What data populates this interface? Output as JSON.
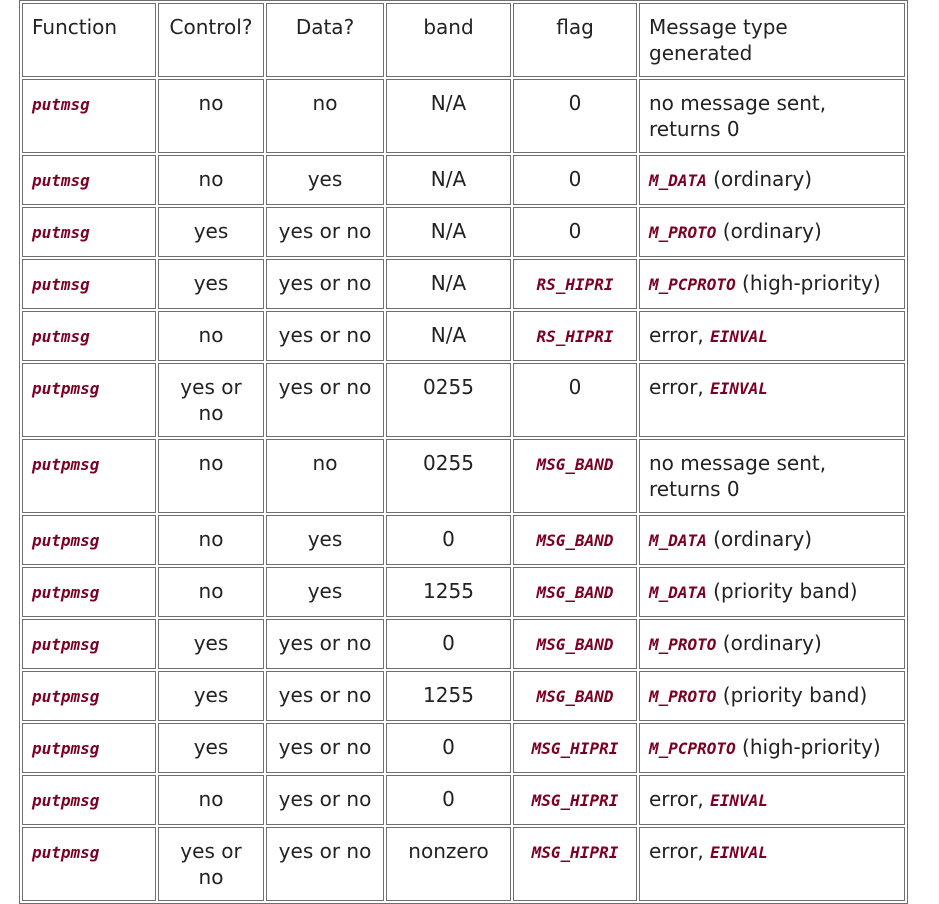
{
  "headers": [
    "Function",
    "Control?",
    "Data?",
    "band",
    "flag",
    "Message type generated"
  ],
  "rows": [
    {
      "function": "putmsg",
      "control": "no",
      "data": "no",
      "band": "N/A",
      "flag": "0",
      "flag_code": false,
      "msg_code": "",
      "msg_text": "no message sent, returns 0"
    },
    {
      "function": "putmsg",
      "control": "no",
      "data": "yes",
      "band": "N/A",
      "flag": "0",
      "flag_code": false,
      "msg_code": "M_DATA",
      "msg_text": " (ordinary)"
    },
    {
      "function": "putmsg",
      "control": "yes",
      "data": "yes or no",
      "band": "N/A",
      "flag": "0",
      "flag_code": false,
      "msg_code": "M_PROTO",
      "msg_text": " (ordinary)"
    },
    {
      "function": "putmsg",
      "control": "yes",
      "data": "yes or no",
      "band": "N/A",
      "flag": "RS_HIPRI",
      "flag_code": true,
      "msg_code": "M_PCPROTO",
      "msg_text": " (high-priority)"
    },
    {
      "function": "putmsg",
      "control": "no",
      "data": "yes or no",
      "band": "N/A",
      "flag": "RS_HIPRI",
      "flag_code": true,
      "msg_prefix": "error, ",
      "msg_code": "EINVAL",
      "msg_text": ""
    },
    {
      "function": "putpmsg",
      "control": "yes or no",
      "data": "yes or no",
      "band": "0255",
      "flag": "0",
      "flag_code": false,
      "msg_prefix": "error, ",
      "msg_code": "EINVAL",
      "msg_text": ""
    },
    {
      "function": "putpmsg",
      "control": "no",
      "data": "no",
      "band": "0255",
      "flag": "MSG_BAND",
      "flag_code": true,
      "msg_code": "",
      "msg_text": "no message sent, returns 0"
    },
    {
      "function": "putpmsg",
      "control": "no",
      "data": "yes",
      "band": "0",
      "flag": "MSG_BAND",
      "flag_code": true,
      "msg_code": "M_DATA",
      "msg_text": " (ordinary)"
    },
    {
      "function": "putpmsg",
      "control": "no",
      "data": "yes",
      "band": "1255",
      "flag": "MSG_BAND",
      "flag_code": true,
      "msg_code": "M_DATA",
      "msg_text": " (priority band)"
    },
    {
      "function": "putpmsg",
      "control": "yes",
      "data": "yes or no",
      "band": "0",
      "flag": "MSG_BAND",
      "flag_code": true,
      "msg_code": "M_PROTO",
      "msg_text": " (ordinary)"
    },
    {
      "function": "putpmsg",
      "control": "yes",
      "data": "yes or no",
      "band": "1255",
      "flag": "MSG_BAND",
      "flag_code": true,
      "msg_code": "M_PROTO",
      "msg_text": " (priority band)"
    },
    {
      "function": "putpmsg",
      "control": "yes",
      "data": "yes or no",
      "band": "0",
      "flag": "MSG_HIPRI",
      "flag_code": true,
      "msg_code": "M_PCPROTO",
      "msg_text": " (high-priority)"
    },
    {
      "function": "putpmsg",
      "control": "no",
      "data": "yes or no",
      "band": "0",
      "flag": "MSG_HIPRI",
      "flag_code": true,
      "msg_prefix": "error, ",
      "msg_code": "EINVAL",
      "msg_text": ""
    },
    {
      "function": "putpmsg",
      "control": "yes or no",
      "data": "yes or no",
      "band": "nonzero",
      "flag": "MSG_HIPRI",
      "flag_code": true,
      "msg_prefix": "error, ",
      "msg_code": "EINVAL",
      "msg_text": ""
    }
  ]
}
